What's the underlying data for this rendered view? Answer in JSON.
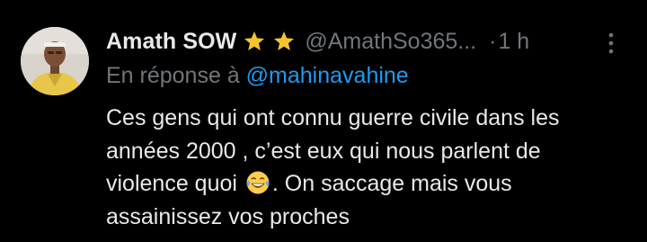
{
  "tweet": {
    "author_name": "Amath SOW",
    "handle": "@AmathSo365...",
    "separator": "·",
    "time": "1 h",
    "reply_prefix": "En réponse à",
    "reply_mention": "@mahinavahine",
    "body_lines": [
      "Ces gens qui ont connu guerre civile dans les",
      "années 2000 , c’est eux qui nous parlent de",
      "violence quoi",
      ".  On saccage mais vous",
      "assainissez vos proches"
    ],
    "emoji": "face-with-tears-of-joy",
    "badges": [
      "star-icon",
      "star-icon"
    ]
  },
  "colors": {
    "background": "#000000",
    "primary_text": "#e7e9ea",
    "secondary_text": "#71767b",
    "link": "#1d9bf0",
    "star": "#f4c430"
  }
}
